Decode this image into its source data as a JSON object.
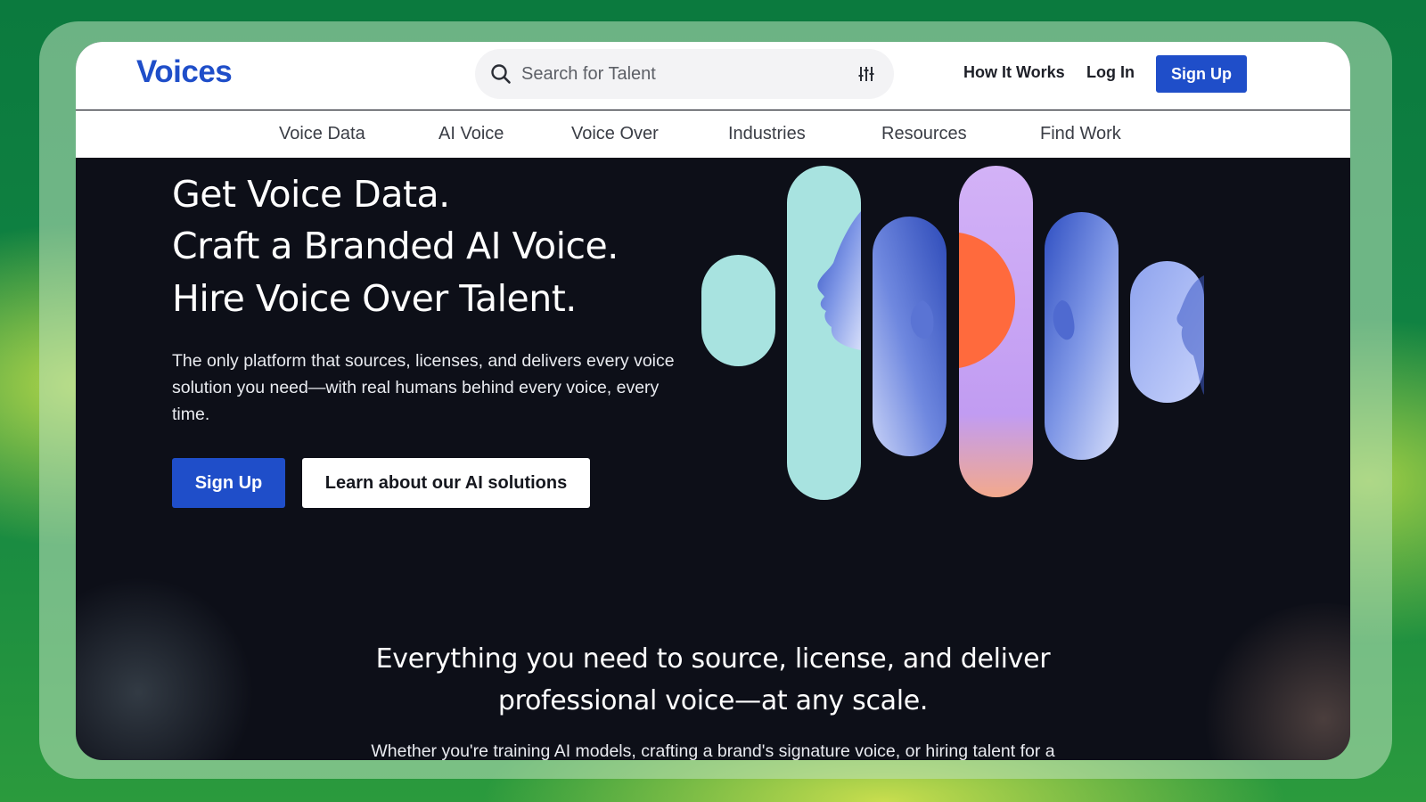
{
  "header": {
    "logo": "Voices",
    "search": {
      "placeholder": "Search for Talent"
    },
    "links": {
      "how_it_works": "How It Works",
      "log_in": "Log In",
      "sign_up": "Sign Up"
    }
  },
  "nav": {
    "items": [
      "Voice Data",
      "AI Voice",
      "Voice Over",
      "Industries",
      "Resources",
      "Find Work"
    ]
  },
  "hero": {
    "lines": [
      "Get Voice Data.",
      "Craft a Branded AI Voice.",
      "Hire Voice Over Talent."
    ],
    "description": "The only platform that sources, licenses, and delivers every voice solution you need—with real humans behind every voice, every time.",
    "primary_button": "Sign Up",
    "secondary_button": "Learn about our AI solutions"
  },
  "section": {
    "title_line1": "Everything you need to source, license, and deliver",
    "title_line2": "professional voice—at any scale.",
    "subtitle": "Whether you're training AI models, crafting a brand's signature voice, or hiring talent for a"
  },
  "colors": {
    "brand_blue": "#1f4ec9",
    "hero_bg": "#0d0f18",
    "pill_teal": "#a8e3e0",
    "pill_lavender": "#c9a6f5",
    "pill_orange": "#ff6a3d",
    "portrait_blue": "#4d6fd6"
  },
  "icons": {
    "search": "search-icon",
    "filter": "sliders-icon"
  }
}
